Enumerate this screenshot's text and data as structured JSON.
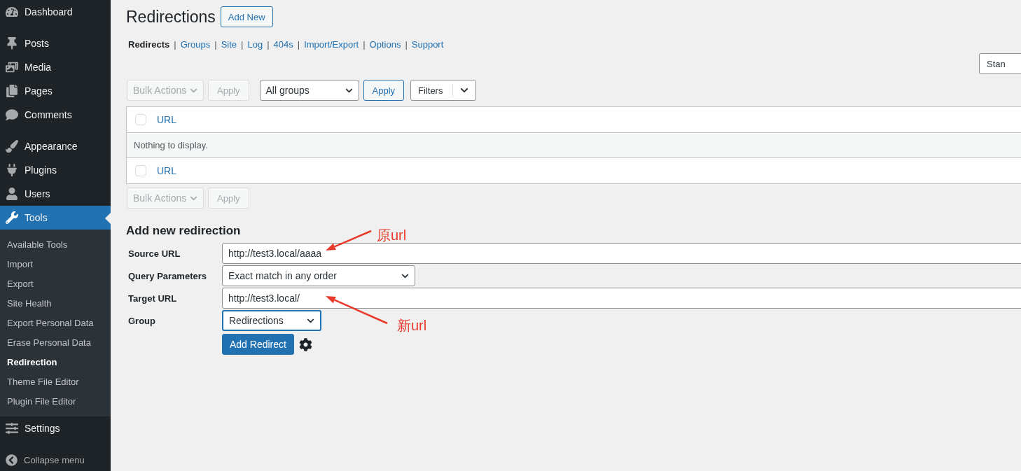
{
  "sidebar": {
    "groups": [
      [
        {
          "label": "Dashboard",
          "selected": false
        }
      ],
      [
        {
          "label": "Posts",
          "selected": false
        },
        {
          "label": "Media",
          "selected": false
        },
        {
          "label": "Pages",
          "selected": false
        },
        {
          "label": "Comments",
          "selected": false
        }
      ],
      [
        {
          "label": "Appearance",
          "selected": false
        },
        {
          "label": "Plugins",
          "selected": false
        },
        {
          "label": "Users",
          "selected": false
        },
        {
          "label": "Tools",
          "selected": true,
          "children": [
            {
              "label": "Available Tools",
              "selected": false
            },
            {
              "label": "Import",
              "selected": false
            },
            {
              "label": "Export",
              "selected": false
            },
            {
              "label": "Site Health",
              "selected": false
            },
            {
              "label": "Export Personal Data",
              "selected": false
            },
            {
              "label": "Erase Personal Data",
              "selected": false
            },
            {
              "label": "Redirection",
              "selected": true
            },
            {
              "label": "Theme File Editor",
              "selected": false
            },
            {
              "label": "Plugin File Editor",
              "selected": false
            }
          ]
        },
        {
          "label": "Settings",
          "selected": false
        }
      ]
    ],
    "collapse": "Collapse menu"
  },
  "page": {
    "title": "Redirections",
    "add_new": "Add New",
    "nav": [
      {
        "label": "Redirects",
        "selected": true
      },
      {
        "label": "Groups",
        "selected": false
      },
      {
        "label": "Site",
        "selected": false
      },
      {
        "label": "Log",
        "selected": false
      },
      {
        "label": "404s",
        "selected": false
      },
      {
        "label": "Import/Export",
        "selected": false
      },
      {
        "label": "Options",
        "selected": false
      },
      {
        "label": "Support",
        "selected": false
      }
    ],
    "nav_separators": [
      "|",
      "|",
      "|",
      "|",
      "|",
      "|",
      "|"
    ],
    "display_button": "Stan",
    "toolbar": {
      "bulk_actions": "Bulk Actions",
      "bulk_disabled": true,
      "apply": "Apply",
      "apply_disabled": true,
      "group_select": "All groups",
      "group_apply": "Apply",
      "filters": "Filters"
    },
    "table": {
      "header": "URL",
      "header_checked": false,
      "empty": "Nothing to display.",
      "footer": "URL",
      "footer_checked": false
    },
    "bottom_toolbar": {
      "bulk_actions": "Bulk Actions",
      "bulk_disabled": true,
      "apply": "Apply",
      "apply_disabled": true
    }
  },
  "form": {
    "heading": "Add new redirection",
    "fields": [
      {
        "kind": "text",
        "label": "Source URL",
        "value": "http://test3.local/aaaa",
        "focused": false
      },
      {
        "kind": "select",
        "label": "Query Parameters",
        "value": "Exact match in any order",
        "focused": false
      },
      {
        "kind": "text",
        "label": "Target URL",
        "value": "http://test3.local/",
        "focused": false
      },
      {
        "kind": "select",
        "label": "Group",
        "value": "Redirections",
        "focused": true
      }
    ],
    "submit": "Add Redirect"
  },
  "annotations": [
    {
      "text": "原url"
    },
    {
      "text": "新url"
    }
  ]
}
